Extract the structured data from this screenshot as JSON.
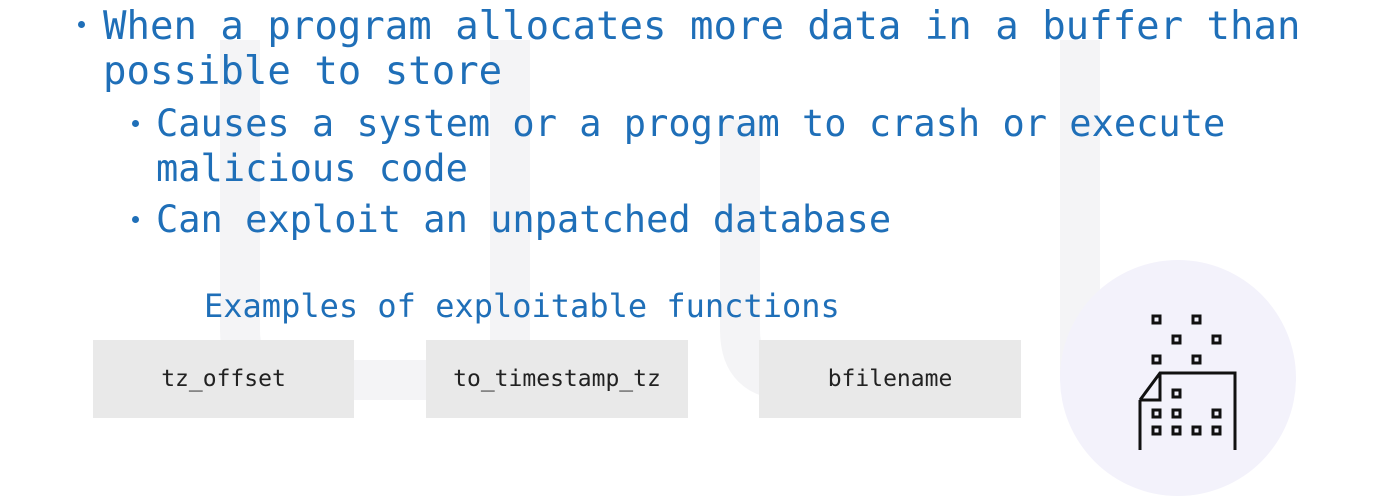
{
  "bullets": [
    {
      "text": "When a program allocates more data in a buffer than possible to store",
      "level": 1
    },
    {
      "text": "Causes a system or a program to crash or execute malicious code",
      "level": 2
    },
    {
      "text": "Can exploit an unpatched database",
      "level": 2
    }
  ],
  "examples": {
    "title": "Examples of exploitable functions",
    "functions": [
      "tz_offset",
      "to_timestamp_tz",
      "bfilename"
    ]
  },
  "illustration": {
    "icon": "file-overflow-icon",
    "circle_color": "#f3f2fb",
    "stroke_color": "#111111"
  },
  "colors": {
    "heading": "#1f6fb8",
    "box": "#e9e9e9"
  }
}
